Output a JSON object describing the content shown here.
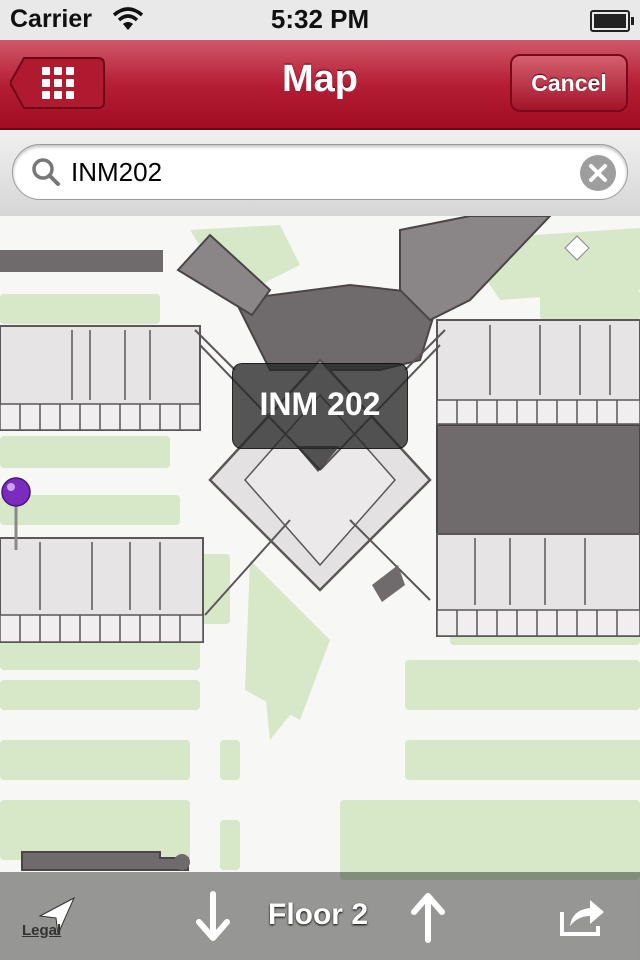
{
  "status_bar": {
    "carrier": "Carrier",
    "time": "5:32 PM"
  },
  "nav_bar": {
    "title": "Map",
    "cancel_label": "Cancel",
    "left_icon": "grid-menu-icon",
    "color": "#b51f35"
  },
  "search": {
    "value": "INM202",
    "icon": "search-icon",
    "clear_icon": "clear-icon"
  },
  "map": {
    "callout_label": "INM 202",
    "pin_color": "#7b2cbf",
    "green_color": "#d6e8c8",
    "building_color": "#6f6a6c"
  },
  "toolbar": {
    "legal_label": "Legal",
    "floor_label": "Floor 2",
    "icons": [
      "location-arrow-icon",
      "arrow-down-icon",
      "arrow-up-icon",
      "share-icon"
    ]
  }
}
